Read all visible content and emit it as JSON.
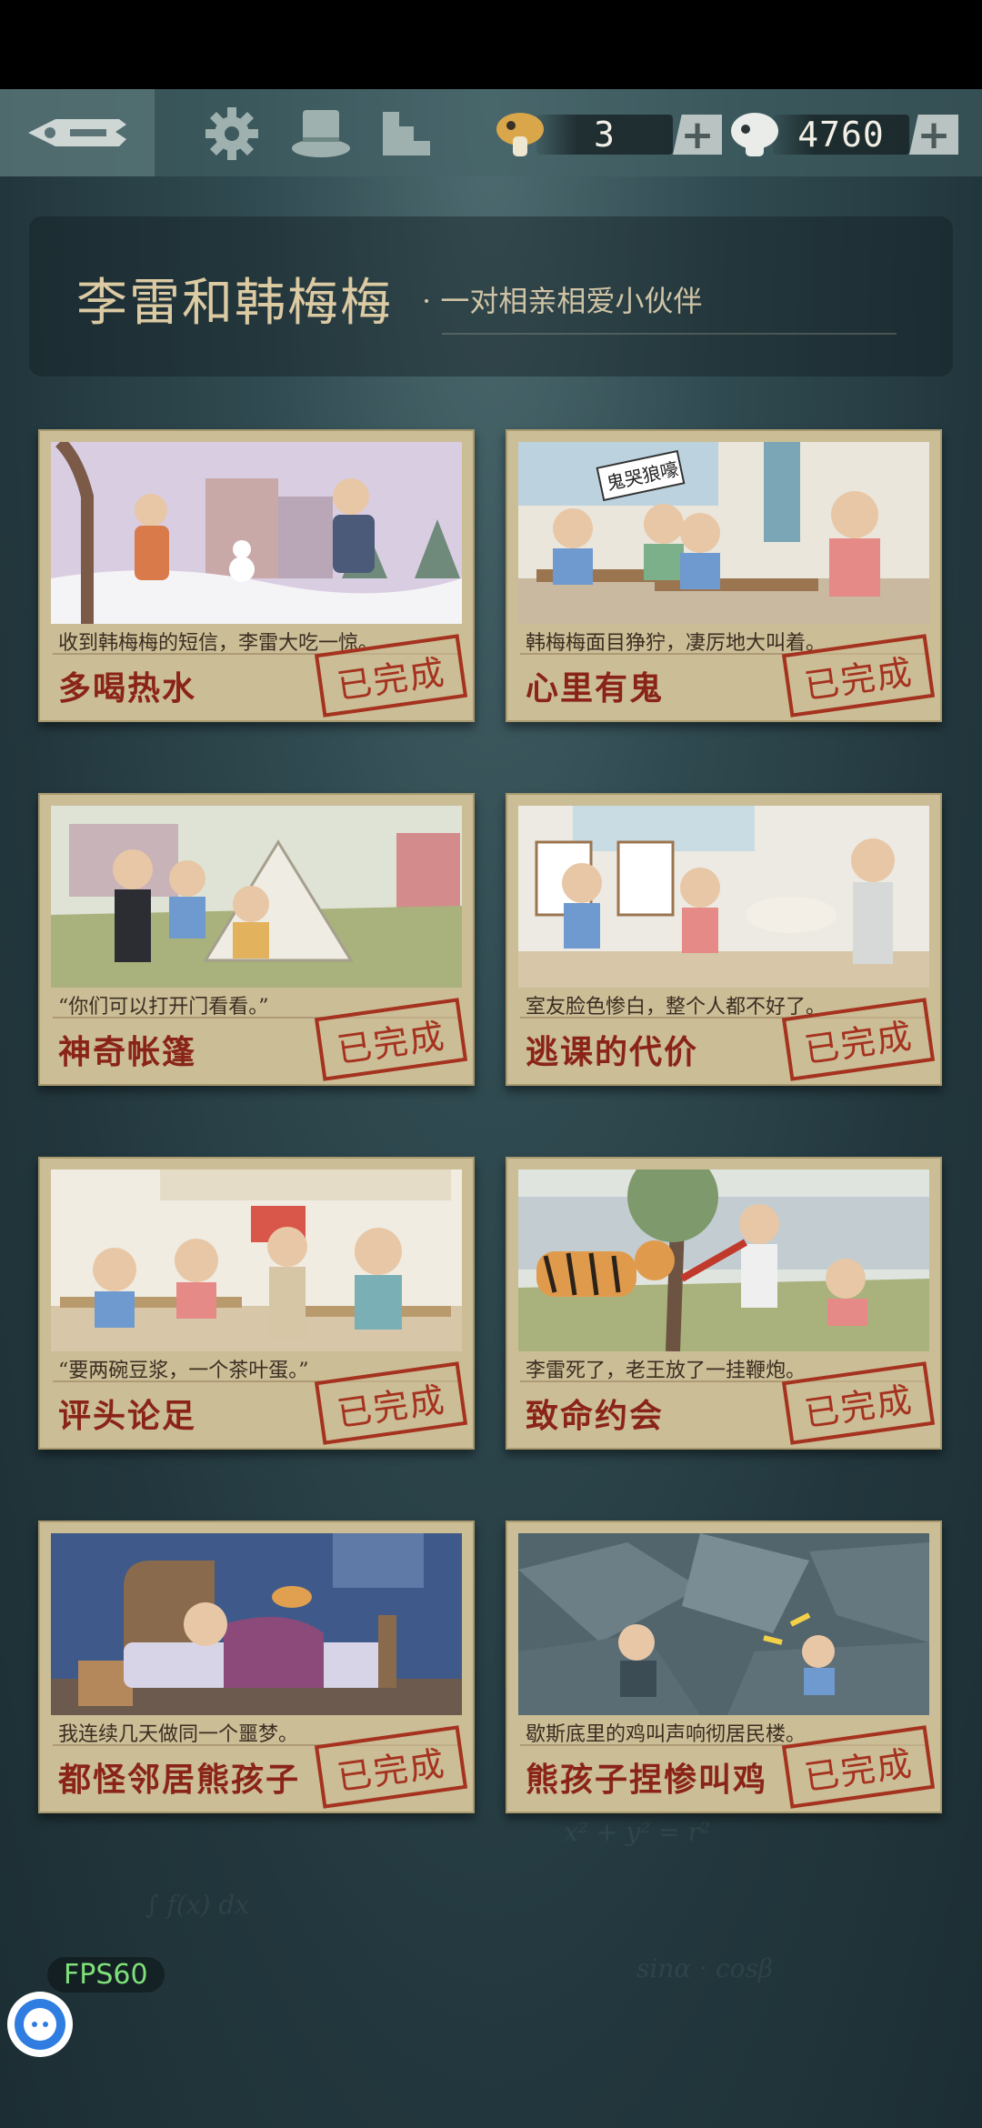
{
  "header": {
    "key_count": "3",
    "coin_count": "4760",
    "plus": "+"
  },
  "chapter": {
    "title": "李雷和韩梅梅",
    "subtitle": "· 一对相亲相爱小伙伴"
  },
  "levels": [
    {
      "desc": "收到韩梅梅的短信，李雷大吃一惊。",
      "title": "多喝热水",
      "status": "已完成"
    },
    {
      "desc": "韩梅梅面目狰狞，凄厉地大叫着。",
      "title": "心里有鬼",
      "status": "已完成"
    },
    {
      "desc": "“你们可以打开门看看。”",
      "title": "神奇帐篷",
      "status": "已完成"
    },
    {
      "desc": "室友脸色惨白，整个人都不好了。",
      "title": "逃课的代价",
      "status": "已完成"
    },
    {
      "desc": "“要两碗豆浆，一个茶叶蛋。”",
      "title": "评头论足",
      "status": "已完成"
    },
    {
      "desc": "李雷死了，老王放了一挂鞭炮。",
      "title": "致命约会",
      "status": "已完成"
    },
    {
      "desc": "我连续几天做同一个噩梦。",
      "title": "都怪邻居熊孩子",
      "status": "已完成"
    },
    {
      "desc": "歇斯底里的鸡叫声响彻居民楼。",
      "title": "熊孩子捏惨叫鸡",
      "status": "已完成"
    }
  ],
  "sign_text": "鬼哭狼嚎",
  "fps_label": "FPS60",
  "colors": {
    "accent": "#8a2418",
    "stamp": "#a5321f",
    "card_bg": "#cbbd96",
    "board": "#22343a"
  }
}
